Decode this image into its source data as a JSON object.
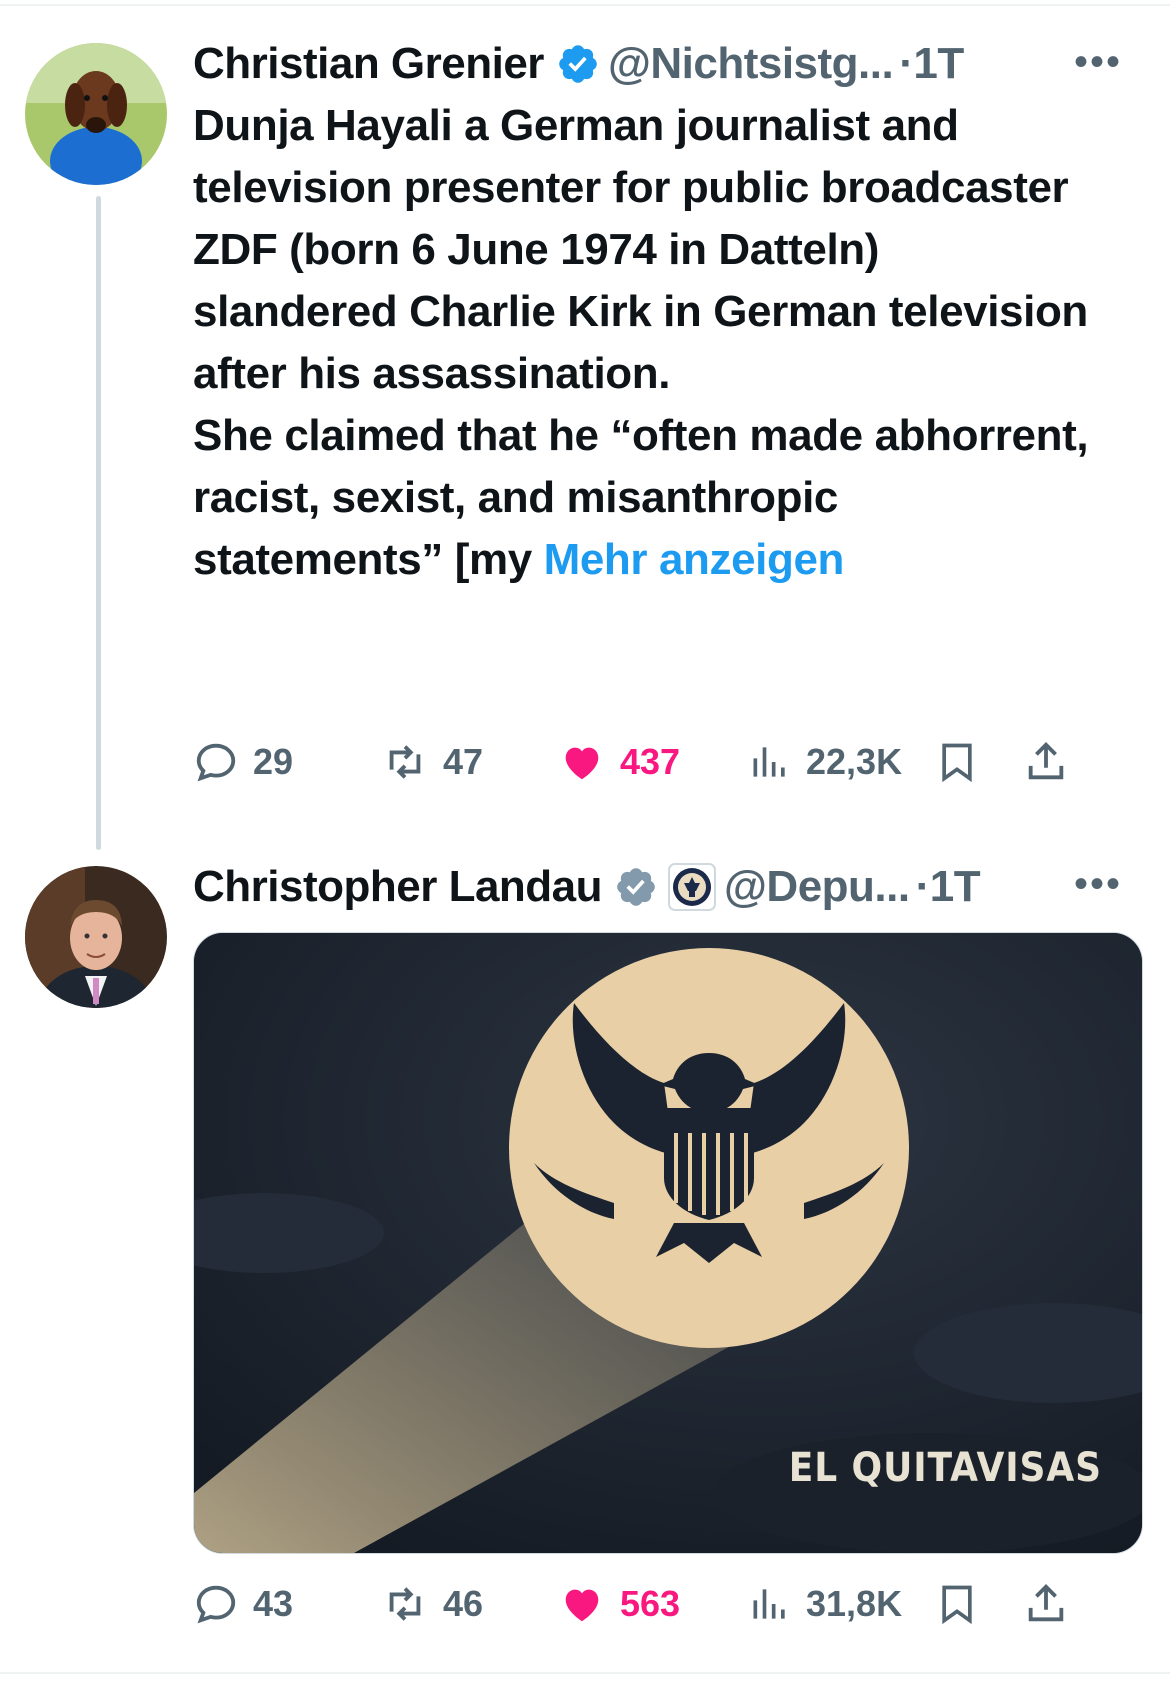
{
  "tweets": [
    {
      "author": "Christian Grenier",
      "handle": "@Nichtsistg...",
      "time": "·1T",
      "text": "Dunja Hayali a German journalist and television presenter for public broadcaster ZDF (born 6 June 1974 in Datteln) slandered Charlie Kirk in German television after his assassination.\nShe claimed that he “often made abhorrent, racist, sexist, and misanthropic statements” [my ",
      "show_more": "Mehr anzeigen",
      "replies": "29",
      "reposts": "47",
      "likes": "437",
      "views": "22,3K"
    },
    {
      "author": "Christopher Landau",
      "handle": "@Depu...",
      "time": "·1T",
      "media_caption": "EL QUITAVISAS",
      "replies": "43",
      "reposts": "46",
      "likes": "563",
      "views": "31,8K"
    }
  ],
  "colors": {
    "verified_blue": "#1d9bf0",
    "verified_gray": "#829aab",
    "like_pink": "#f91880",
    "muted": "#536471"
  },
  "icons": [
    "reply-icon",
    "repost-icon",
    "heart-icon",
    "views-icon",
    "bookmark-icon",
    "share-icon",
    "more-icon",
    "verified-icon",
    "state-seal-icon"
  ]
}
